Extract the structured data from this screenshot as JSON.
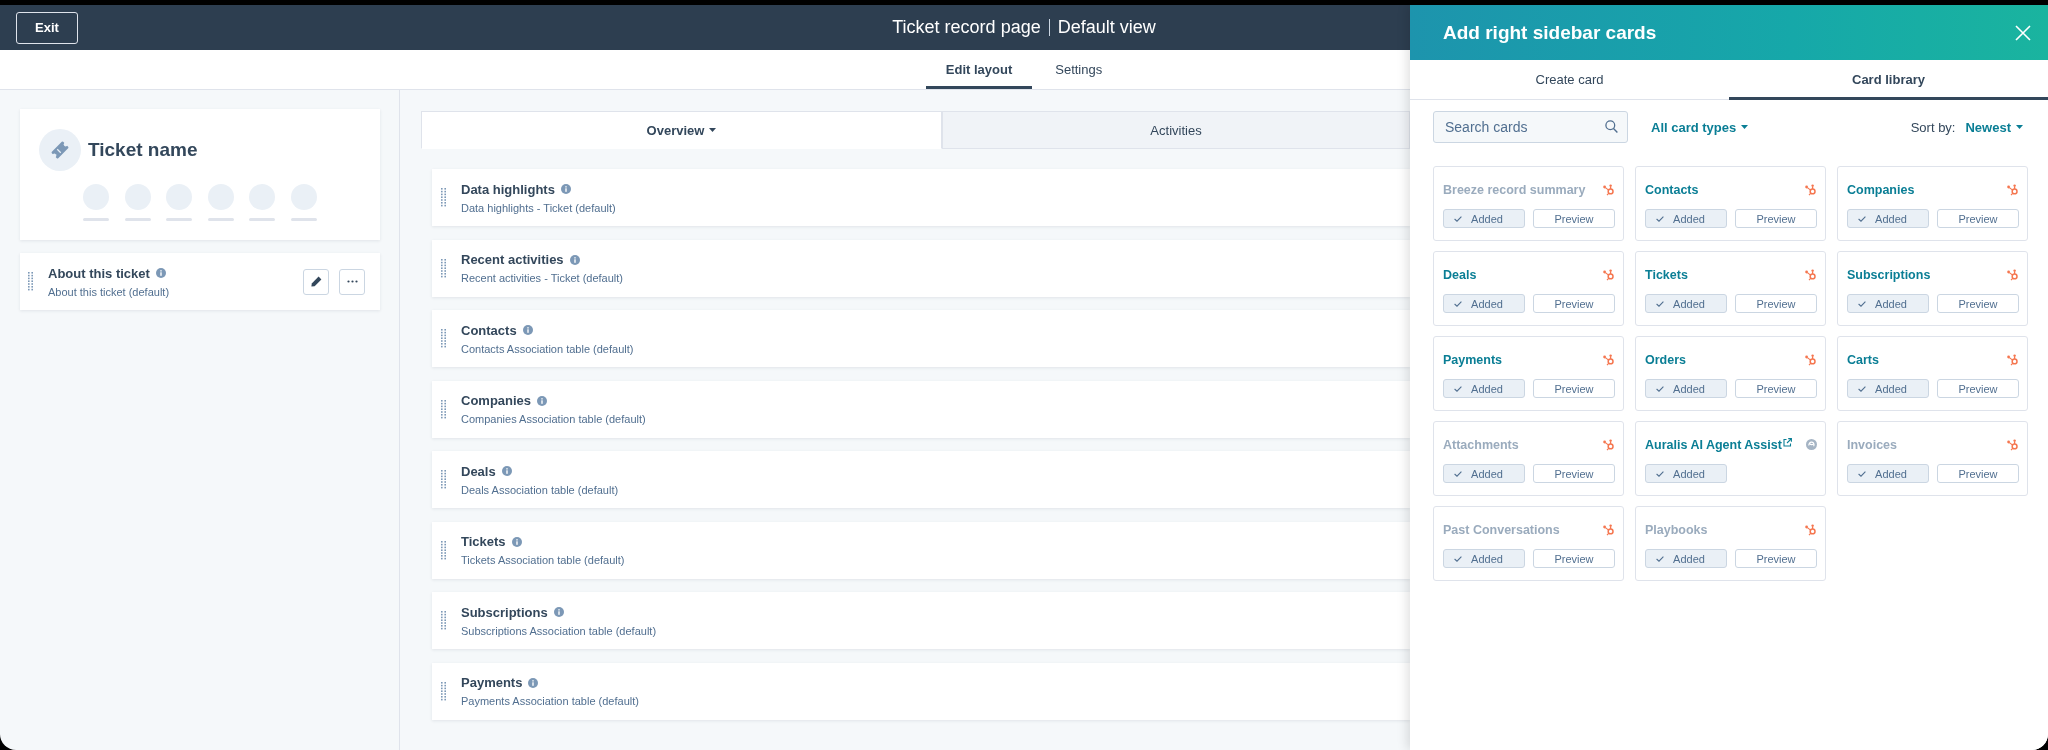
{
  "header": {
    "exit_button": "Exit",
    "title": "Ticket record page",
    "view": "Default view"
  },
  "layout_tabs": [
    {
      "label": "Edit layout",
      "selected": true
    },
    {
      "label": "Settings",
      "selected": false
    }
  ],
  "left_sidebar": {
    "record_title": "Ticket name",
    "cards": [
      {
        "title": "About this ticket",
        "subtitle": "About this ticket (default)"
      }
    ]
  },
  "content_tabs": [
    {
      "label": "Overview",
      "selected": true,
      "dropdown": true
    },
    {
      "label": "Activities",
      "selected": false,
      "dropdown": false
    }
  ],
  "overview_cards": [
    {
      "title": "Data highlights",
      "subtitle": "Data highlights - Ticket (default)"
    },
    {
      "title": "Recent activities",
      "subtitle": "Recent activities - Ticket (default)"
    },
    {
      "title": "Contacts",
      "subtitle": "Contacts Association table (default)"
    },
    {
      "title": "Companies",
      "subtitle": "Companies Association table (default)"
    },
    {
      "title": "Deals",
      "subtitle": "Deals Association table (default)"
    },
    {
      "title": "Tickets",
      "subtitle": "Tickets Association table (default)"
    },
    {
      "title": "Subscriptions",
      "subtitle": "Subscriptions Association table (default)"
    },
    {
      "title": "Payments",
      "subtitle": "Payments Association table (default)"
    }
  ],
  "sidebar_panel": {
    "title": "Add right sidebar cards",
    "tabs": [
      {
        "label": "Create card",
        "selected": false
      },
      {
        "label": "Card library",
        "selected": true
      }
    ],
    "search": {
      "placeholder": "Search cards"
    },
    "filter": "All card types",
    "sort": {
      "label": "Sort by:",
      "value": "Newest"
    },
    "cards": [
      {
        "title": "Breeze record summary",
        "kind": "hubspot",
        "disabled": true,
        "added": true,
        "added_label": "Added",
        "preview_label": "Preview"
      },
      {
        "title": "Contacts",
        "kind": "hubspot",
        "disabled": false,
        "added": true,
        "added_label": "Added",
        "preview_label": "Preview"
      },
      {
        "title": "Companies",
        "kind": "hubspot",
        "disabled": false,
        "added": true,
        "added_label": "Added",
        "preview_label": "Preview"
      },
      {
        "title": "Deals",
        "kind": "hubspot",
        "disabled": false,
        "added": true,
        "added_label": "Added",
        "preview_label": "Preview"
      },
      {
        "title": "Tickets",
        "kind": "hubspot",
        "disabled": false,
        "added": true,
        "added_label": "Added",
        "preview_label": "Preview"
      },
      {
        "title": "Subscriptions",
        "kind": "hubspot",
        "disabled": false,
        "added": true,
        "added_label": "Added",
        "preview_label": "Preview"
      },
      {
        "title": "Payments",
        "kind": "hubspot",
        "disabled": false,
        "added": true,
        "added_label": "Added",
        "preview_label": "Preview"
      },
      {
        "title": "Orders",
        "kind": "hubspot",
        "disabled": false,
        "added": true,
        "added_label": "Added",
        "preview_label": "Preview"
      },
      {
        "title": "Carts",
        "kind": "hubspot",
        "disabled": false,
        "added": true,
        "added_label": "Added",
        "preview_label": "Preview"
      },
      {
        "title": "Attachments",
        "kind": "hubspot",
        "disabled": true,
        "added": true,
        "added_label": "Added",
        "preview_label": "Preview"
      },
      {
        "title": "Auralis AI Agent Assist",
        "kind": "app",
        "disabled": false,
        "added": true,
        "added_label": "Added"
      },
      {
        "title": "Invoices",
        "kind": "hubspot",
        "disabled": true,
        "added": true,
        "added_label": "Added",
        "preview_label": "Preview"
      },
      {
        "title": "Past Conversations",
        "kind": "hubspot",
        "disabled": true,
        "added": true,
        "added_label": "Added",
        "preview_label": "Preview"
      },
      {
        "title": "Playbooks",
        "kind": "hubspot",
        "disabled": true,
        "added": true,
        "added_label": "Added",
        "preview_label": "Preview"
      }
    ]
  }
}
